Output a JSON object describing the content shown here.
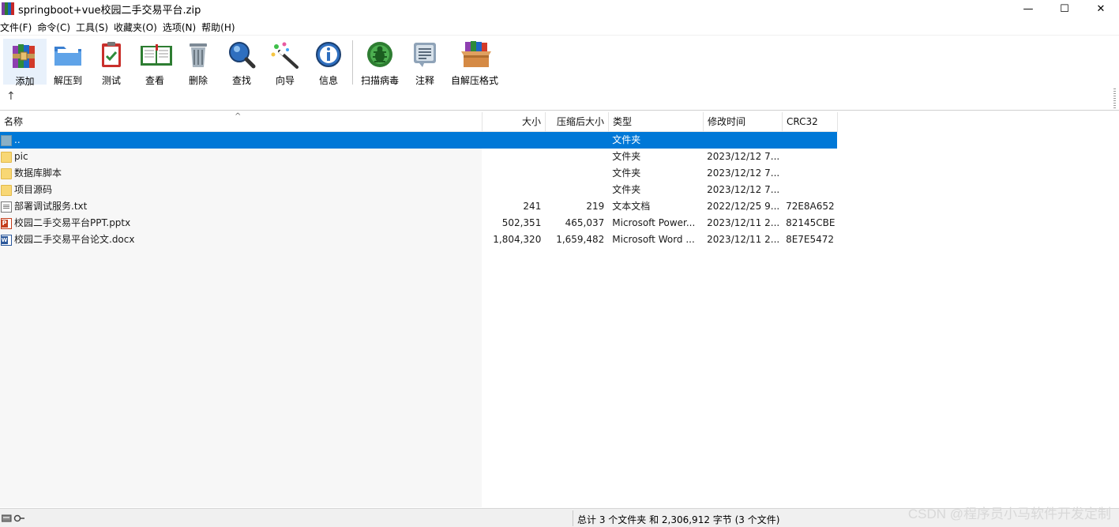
{
  "window": {
    "title": "springboot+vue校园二手交易平台.zip",
    "minimize": "—",
    "maximize": "☐",
    "close": "✕"
  },
  "menu": [
    "文件(F)",
    "命令(C)",
    "工具(S)",
    "收藏夹(O)",
    "选项(N)",
    "帮助(H)"
  ],
  "toolbar": {
    "add": "添加",
    "extract_to": "解压到",
    "test": "测试",
    "view": "查看",
    "delete": "删除",
    "find": "查找",
    "wizard": "向导",
    "info": "信息",
    "virus_scan": "扫描病毒",
    "comment": "注释",
    "sfx": "自解压格式"
  },
  "address": {
    "up_icon": "↑"
  },
  "columns": {
    "name": "名称",
    "size": "大小",
    "packed": "压缩后大小",
    "type": "类型",
    "modified": "修改时间",
    "crc": "CRC32"
  },
  "rows": [
    {
      "name": "..",
      "size": "",
      "packed": "",
      "type": "文件夹",
      "modified": "",
      "crc": "",
      "icon": "folder-up-icon"
    },
    {
      "name": "pic",
      "size": "",
      "packed": "",
      "type": "文件夹",
      "modified": "2023/12/12 7...",
      "crc": "",
      "icon": "folder-icon"
    },
    {
      "name": "数据库脚本",
      "size": "",
      "packed": "",
      "type": "文件夹",
      "modified": "2023/12/12 7...",
      "crc": "",
      "icon": "folder-icon"
    },
    {
      "name": "项目源码",
      "size": "",
      "packed": "",
      "type": "文件夹",
      "modified": "2023/12/12 7...",
      "crc": "",
      "icon": "folder-icon"
    },
    {
      "name": "部署调试服务.txt",
      "size": "241",
      "packed": "219",
      "type": "文本文档",
      "modified": "2022/12/25 9...",
      "crc": "72E8A652",
      "icon": "text-file-icon"
    },
    {
      "name": "校园二手交易平台PPT.pptx",
      "size": "502,351",
      "packed": "465,037",
      "type": "Microsoft Power...",
      "modified": "2023/12/11 2...",
      "crc": "82145CBE",
      "icon": "powerpoint-file-icon"
    },
    {
      "name": "校园二手交易平台论文.docx",
      "size": "1,804,320",
      "packed": "1,659,482",
      "type": "Microsoft Word ...",
      "modified": "2023/12/11 2...",
      "crc": "8E7E5472",
      "icon": "word-file-icon"
    }
  ],
  "status": {
    "summary": "总计 3 个文件夹 和 2,306,912 字节 (3 个文件)"
  },
  "watermark": "CSDN @程序员小马软件开发定制",
  "colors": {
    "selection": "#0078d7",
    "folder": "#f8d775"
  }
}
